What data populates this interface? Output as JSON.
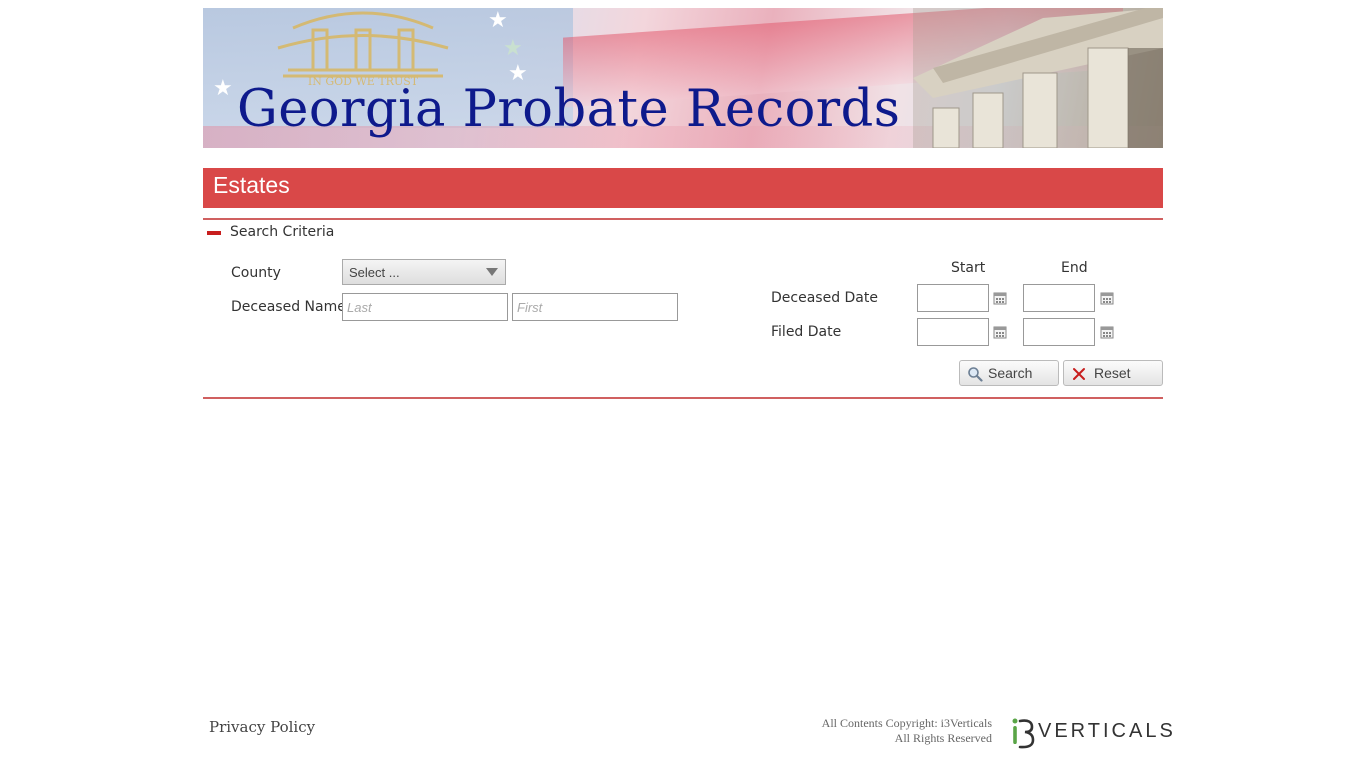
{
  "banner": {
    "title": "Georgia Probate Records"
  },
  "section": {
    "title": "Estates"
  },
  "search_criteria": {
    "label": "Search Criteria",
    "county_label": "County",
    "county_value": "Select ...",
    "deceased_name_label": "Deceased Name",
    "last_placeholder": "Last",
    "first_placeholder": "First",
    "start_header": "Start",
    "end_header": "End",
    "deceased_date_label": "Deceased Date",
    "filed_date_label": "Filed Date"
  },
  "buttons": {
    "search_label": "Search",
    "reset_label": "Reset"
  },
  "footer": {
    "privacy_label": "Privacy Policy",
    "copyright_line1": "All Contents Copyright:  i3Verticals",
    "copyright_line2": "All Rights Reserved",
    "logo_text": "VERTICALS"
  },
  "colors": {
    "accent_red": "#d94848",
    "title_blue": "#0e1a8c"
  }
}
